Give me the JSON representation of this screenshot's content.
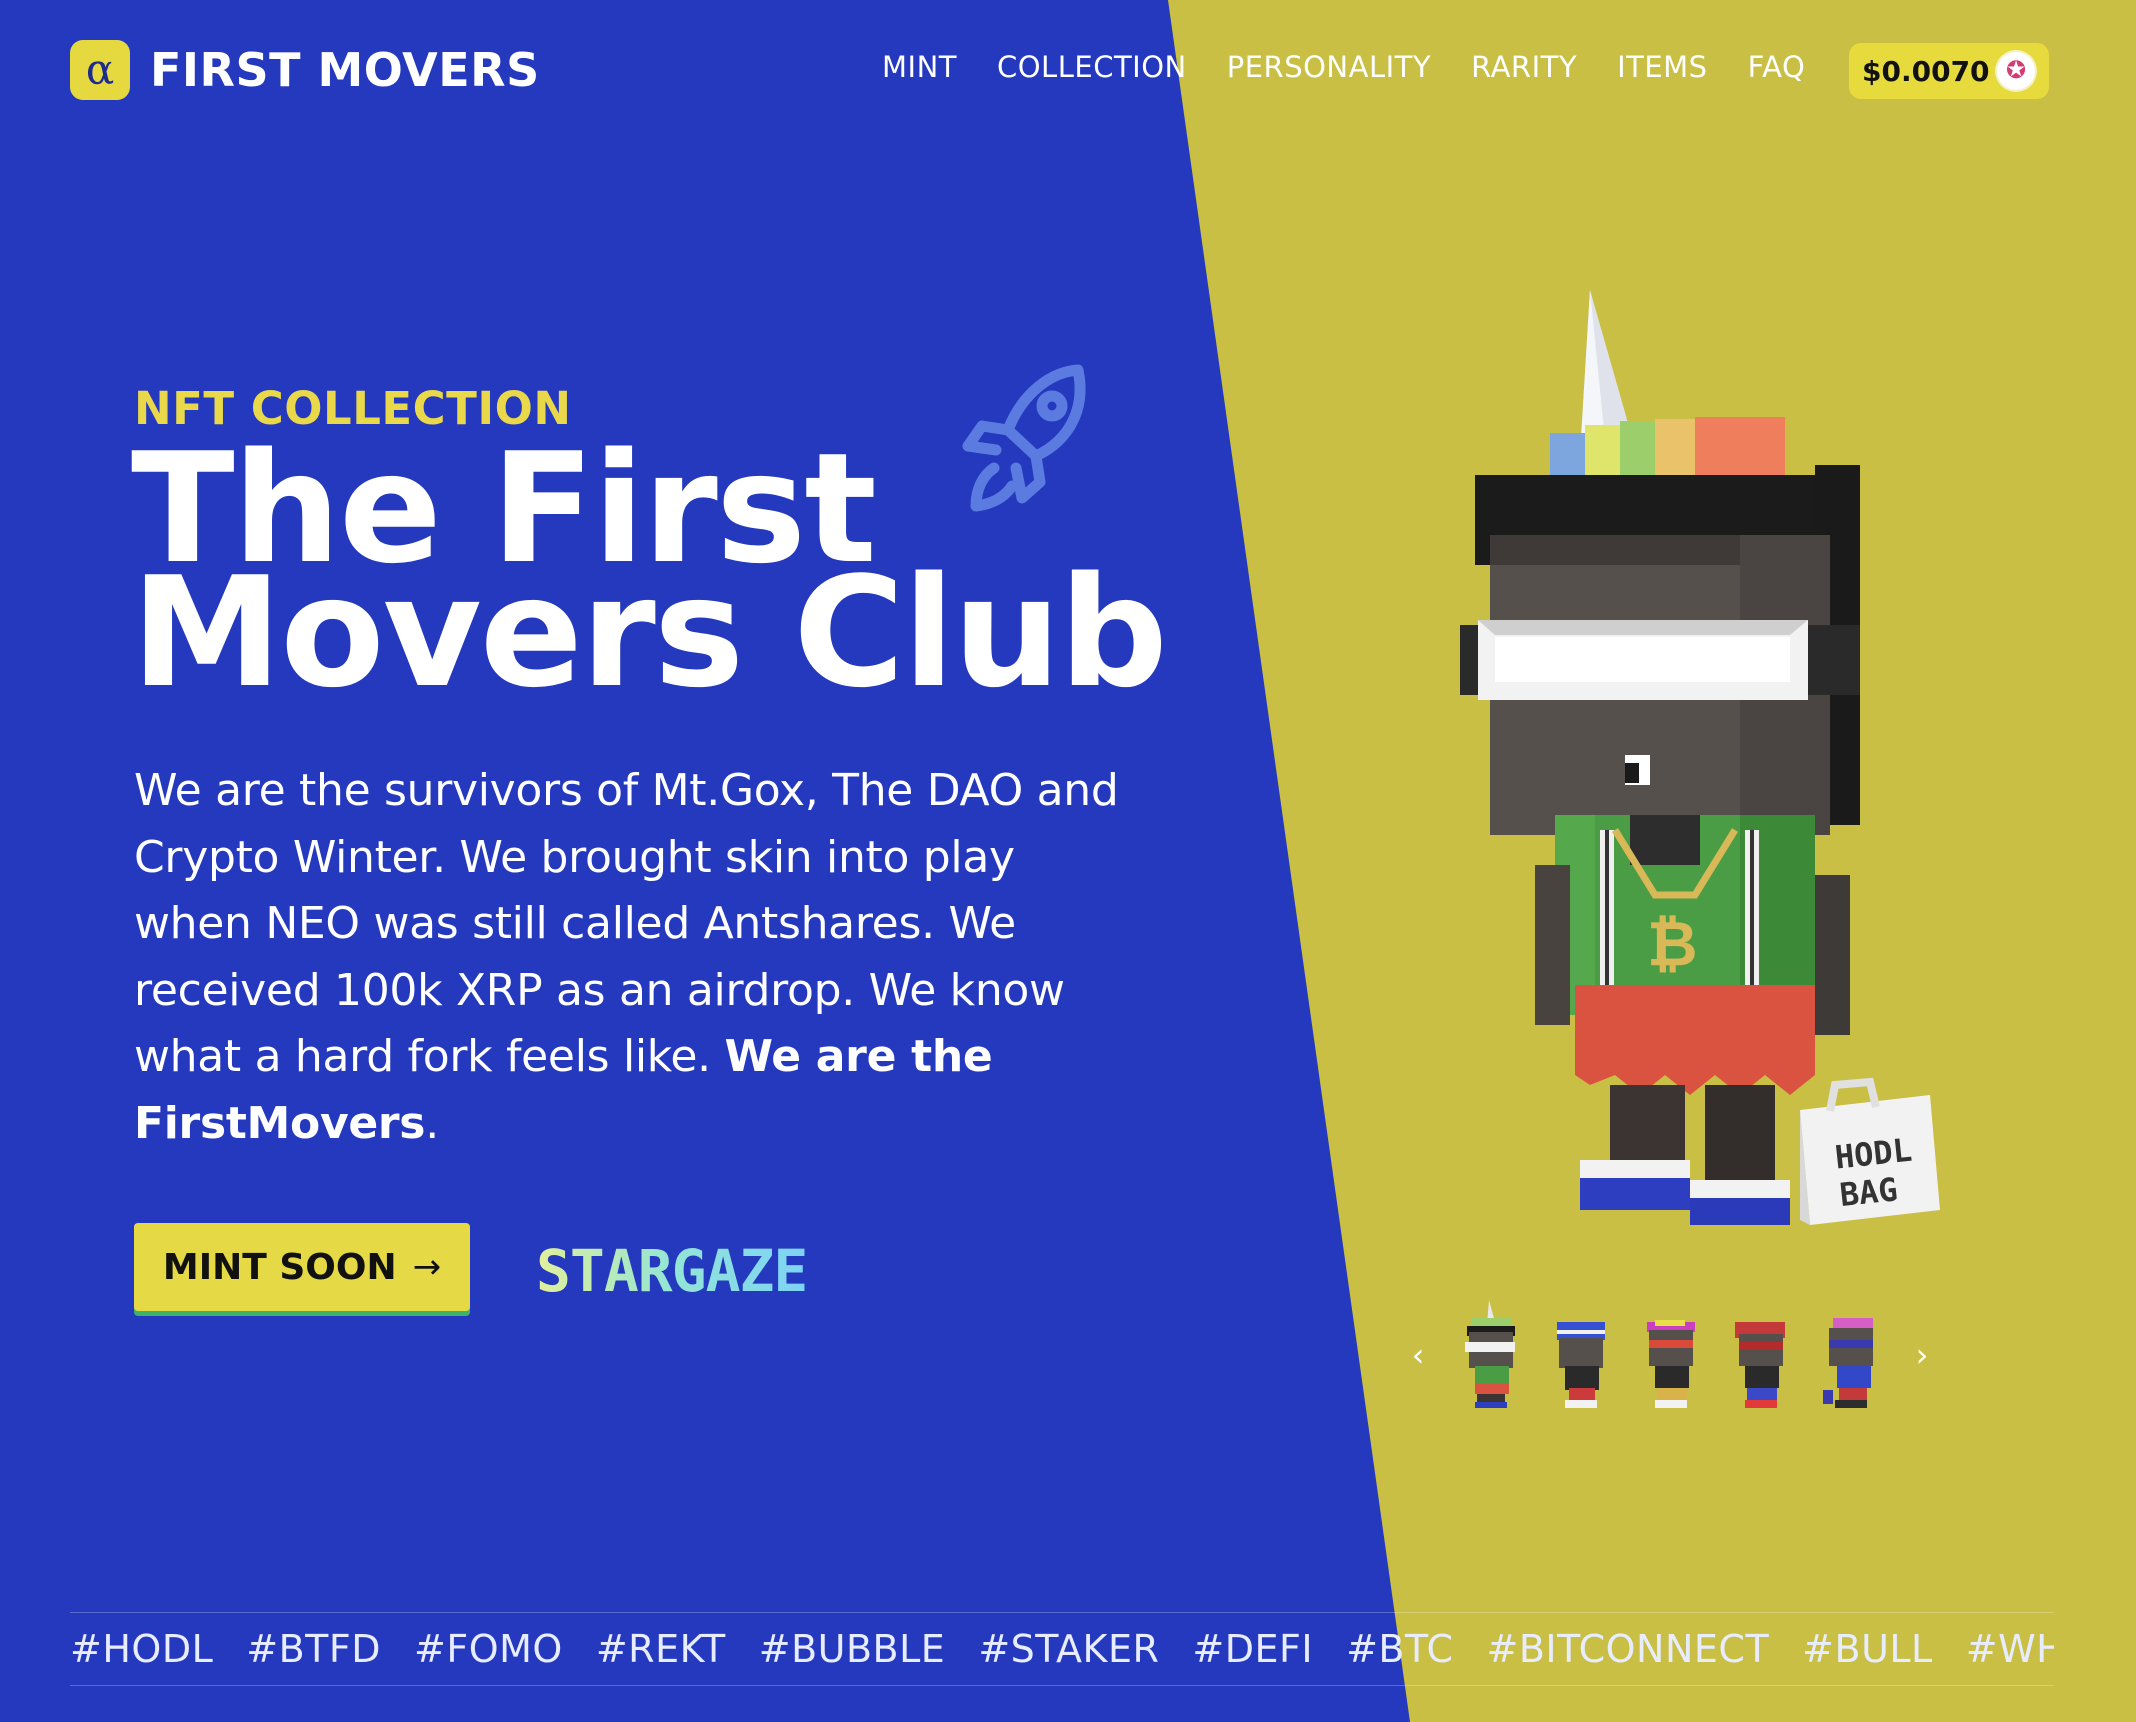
{
  "brand": {
    "logo_glyph": "α",
    "name": "FIRST MOVERS"
  },
  "nav": {
    "items": [
      "MINT",
      "COLLECTION",
      "PERSONALITY",
      "RARITY",
      "ITEMS",
      "FAQ"
    ]
  },
  "price": {
    "value": "$0.0070",
    "icon": "stargaze-coin-icon"
  },
  "hero": {
    "eyebrow": "NFT COLLECTION",
    "title_line1": "The First",
    "title_line2": "Movers Club",
    "description": "We are the survivors of Mt.Gox, The DAO and Crypto Winter. We brought skin into play when NEO was still called Antshares. We received 100k XRP as an airdrop. We know what a hard fork feels like.",
    "description_bold": "We are the FirstMovers",
    "description_end": ".",
    "cta_label": "MINT SOON",
    "cta_arrow": "→",
    "partner_logo": "STARGAZE"
  },
  "carousel": {
    "prev": "‹",
    "next": "›",
    "thumb_count": 5,
    "character_bag_text_line1": "HODL",
    "character_bag_text_line2": "BAG"
  },
  "hashtags": [
    "#HODL",
    "#BTFD",
    "#FOMO",
    "#REKT",
    "#BUBBLE",
    "#STAKER",
    "#DEFI",
    "#BTC",
    "#BITCONNECT",
    "#BULL",
    "#WHALE"
  ],
  "colors": {
    "blue": "#2439bd",
    "yellow": "#c9bf45",
    "accent_yellow": "#e6da3c",
    "green_underline": "#3db36a"
  }
}
